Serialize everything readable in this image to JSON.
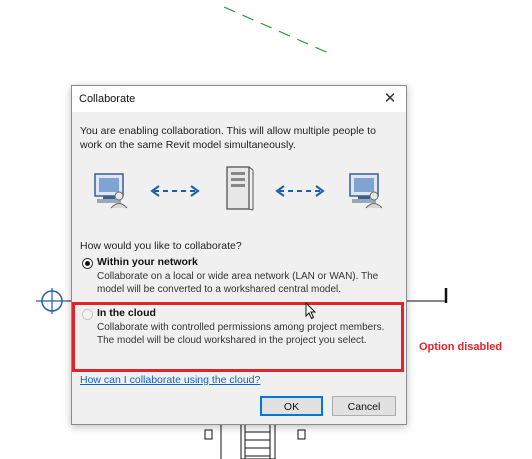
{
  "dialog": {
    "title": "Collaborate",
    "close_glyph": "✕",
    "intro": "You are enabling collaboration. This will allow multiple people to work on the same Revit model simultaneously.",
    "illustration": {
      "left_icon": "computer-user-icon",
      "center_icon": "server-icon",
      "right_icon": "computer-user-icon",
      "arrow": "double-dashed-arrow-icon"
    },
    "question": "How would you like to collaborate?",
    "options": [
      {
        "title": "Within your network",
        "description": "Collaborate on a local or wide area network (LAN or WAN). The model will be converted to a workshared central model.",
        "selected": true,
        "enabled": true
      },
      {
        "title": "In the cloud",
        "description": "Collaborate with controlled permissions among project members. The model will be cloud workshared in the project you select.",
        "selected": false,
        "enabled": false
      }
    ],
    "help_link": "How can I collaborate using the cloud?",
    "ok_label": "OK",
    "cancel_label": "Cancel"
  },
  "annotation": {
    "text": "Option disabled",
    "color": "#e0242a"
  },
  "colors": {
    "accent": "#0078d7",
    "link": "#0b63c6",
    "icon_blue": "#1f5fae"
  }
}
